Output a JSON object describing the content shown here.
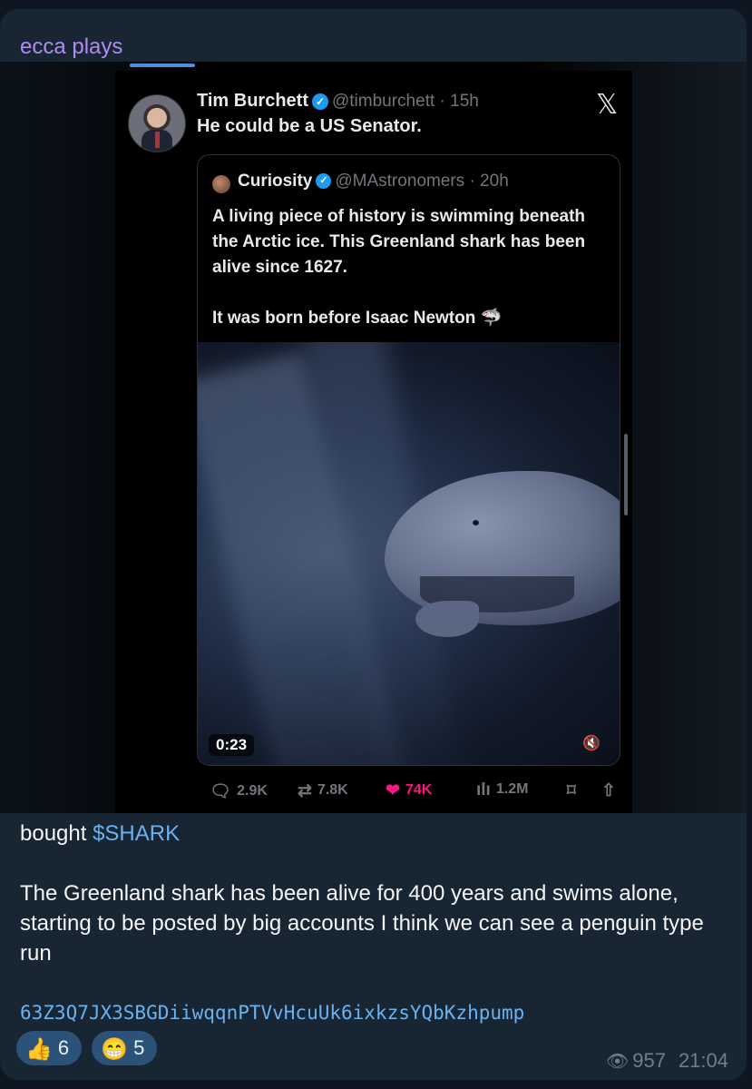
{
  "message": {
    "sender": "ecca plays",
    "text_prefix": "bought ",
    "ticker": "$SHARK",
    "paragraph": "The Greenland shark has been alive for 400 years and swims alone, starting to be posted by big accounts I think we can see a penguin type run",
    "contract_address": "63Z3Q7JX3SBGDiiwqqnPTVvHcuUk6ixkzsYQbKzhpump",
    "views": "957",
    "time": "21:04"
  },
  "reactions": [
    {
      "emoji": "👍",
      "count": "6"
    },
    {
      "emoji": "😁",
      "count": "5"
    }
  ],
  "tweet": {
    "author": "Tim Burchett",
    "handle": "@timburchett · 15h",
    "text": "He could be a US Senator.",
    "logo": "𝕏",
    "quote": {
      "author": "Curiosity",
      "handle": "@MAstronomers · 20h",
      "line1": "A living piece of history is swimming beneath the Arctic ice. This Greenland shark has been alive since 1627.",
      "line2": "It was born before Isaac Newton 🦈",
      "video_time": "0:23"
    },
    "stats": {
      "replies": "2.9K",
      "reposts": "7.8K",
      "likes": "74K",
      "views": "1.2M"
    }
  },
  "icons": {
    "reply": "🗨",
    "repost": "⇄",
    "like": "❤",
    "views": "📊",
    "bookmark": "🔖",
    "share": "⇪",
    "mute": "🔇",
    "eye": "👁"
  }
}
